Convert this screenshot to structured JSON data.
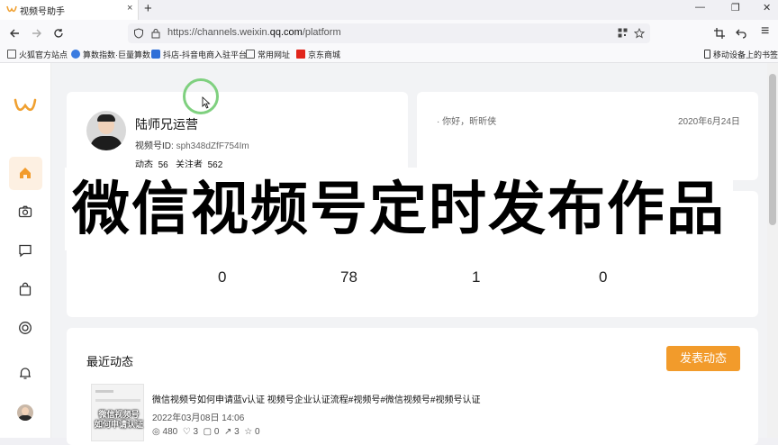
{
  "browser": {
    "tab_title": "视频号助手",
    "tab_close": "×",
    "new_tab": "+",
    "win_min": "—",
    "win_restore": "❐",
    "win_close": "✕",
    "url_prefix": "https://channels.weixin.",
    "url_domain": "qq.com",
    "url_path": "/platform",
    "bookmarks": [
      {
        "label": "火狐官方站点",
        "icon": "folder-icon"
      },
      {
        "label": "算数指数·巨量算数",
        "icon": "swirl-icon"
      },
      {
        "label": "抖店-抖音电商入驻平台",
        "icon": "shop-icon"
      },
      {
        "label": "常用网址",
        "icon": "folder-icon"
      },
      {
        "label": "京东商城",
        "icon": "jd-icon"
      }
    ],
    "mobile_bookmarks": "移动设备上的书签"
  },
  "profile": {
    "name": "陆师兄运营",
    "id_label": "视频号ID:",
    "id_value": "sph348dZfF754Im",
    "posts_label": "动态",
    "posts_value": "56",
    "followers_label": "关注者",
    "followers_value": "562"
  },
  "notice": {
    "text": "你好，昕昕侠",
    "date": "2020年6月24日"
  },
  "overlay": {
    "title": "微信视频号定时发布作品"
  },
  "stats": [
    "0",
    "78",
    "1",
    "0"
  ],
  "recent": {
    "heading": "最近动态",
    "post_button": "发表动态",
    "items": [
      {
        "title": "微信视频号如何申请蓝v认证 视频号企业认证流程#视频号#微信视频号#视频号认证",
        "date": "2022年03月08日 14:06",
        "thumb_text": "微信视频号 如何申请认证",
        "metrics": [
          "480",
          "3",
          "0",
          "3",
          "0"
        ]
      }
    ]
  },
  "colors": {
    "accent": "#f29b2b",
    "logo": "#f0a030"
  }
}
